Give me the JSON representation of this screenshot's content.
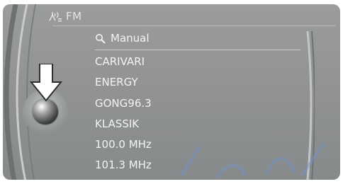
{
  "header": {
    "source_label": "FM",
    "antenna_icon": "antenna-icon"
  },
  "list": {
    "search_label": "Manual",
    "stations": [
      "CARIVARI",
      "ENERGY",
      "GONG96.3",
      "KLASSIK",
      "100.0 MHz",
      "101.3 MHz"
    ]
  },
  "controller": {
    "push_hint_icon": "down-arrow-icon",
    "knob_icon": "controller-knob-icon"
  },
  "colors": {
    "panel": "#8e9091",
    "text": "#f2f3f4",
    "title": "#e2e4e5"
  }
}
